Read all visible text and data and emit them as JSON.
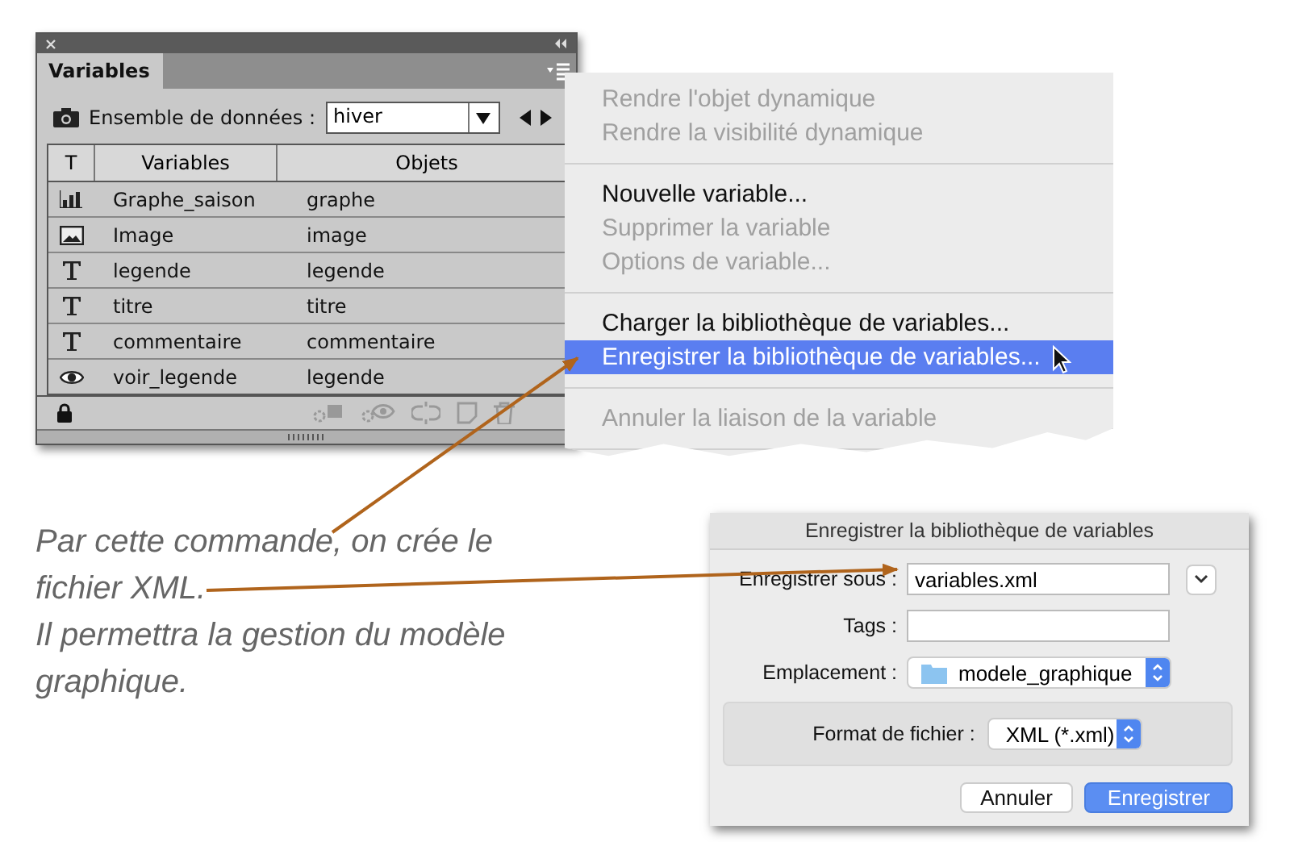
{
  "panel": {
    "tab": "Variables",
    "dataset_label": "Ensemble de données :",
    "dataset_value": "hiver",
    "columns": [
      "T",
      "Variables",
      "Objets"
    ],
    "rows": [
      {
        "kind": "graph",
        "variable": "Graphe_saison",
        "object": "graphe"
      },
      {
        "kind": "image",
        "variable": "Image",
        "object": "image"
      },
      {
        "kind": "text",
        "variable": "legende",
        "object": "legende"
      },
      {
        "kind": "text",
        "variable": "titre",
        "object": "titre"
      },
      {
        "kind": "text",
        "variable": "commentaire",
        "object": "commentaire"
      },
      {
        "kind": "visibility",
        "variable": "voir_legende",
        "object": "legende"
      }
    ]
  },
  "menu": {
    "groups": [
      [
        {
          "label": "Rendre l'objet dynamique",
          "disabled": true,
          "selected": false
        },
        {
          "label": "Rendre la visibilité dynamique",
          "disabled": true,
          "selected": false
        }
      ],
      [
        {
          "label": "Nouvelle variable...",
          "disabled": false,
          "selected": false
        },
        {
          "label": "Supprimer la variable",
          "disabled": true,
          "selected": false
        },
        {
          "label": "Options de variable...",
          "disabled": true,
          "selected": false
        }
      ],
      [
        {
          "label": "Charger la bibliothèque de variables...",
          "disabled": false,
          "selected": false
        },
        {
          "label": "Enregistrer la bibliothèque de variables...",
          "disabled": false,
          "selected": true
        }
      ],
      [
        {
          "label": "Annuler la liaison de la variable",
          "disabled": true,
          "selected": false
        }
      ]
    ]
  },
  "annotation": [
    "Par cette commande, on crée le fichier XML.",
    "Il permettra la gestion du modèle graphique."
  ],
  "dialog": {
    "title": "Enregistrer la bibliothèque de variables",
    "save_as_label": "Enregistrer sous :",
    "save_as_value": "variables.xml",
    "tags_label": "Tags :",
    "location_label": "Emplacement :",
    "location_value": "modele_graphique",
    "format_label": "Format de fichier :",
    "format_value": "XML (*.xml)",
    "buttons": [
      {
        "label": "Annuler",
        "default": false
      },
      {
        "label": "Enregistrer",
        "default": true
      }
    ]
  }
}
